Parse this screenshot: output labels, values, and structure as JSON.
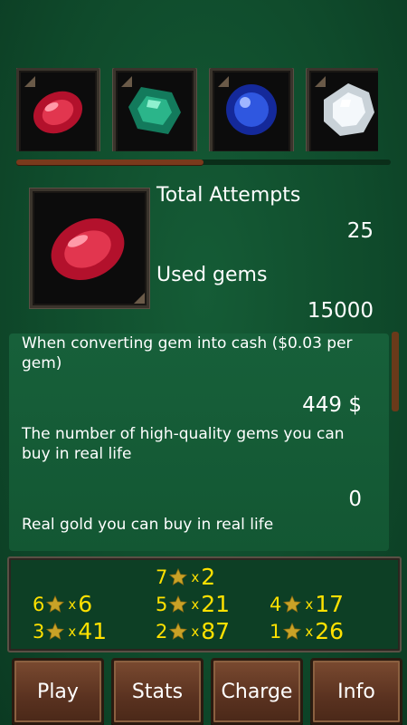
{
  "gems": {
    "strip": [
      {
        "name": "ruby",
        "color": "#c8203a"
      },
      {
        "name": "emerald",
        "color": "#1f9e7a"
      },
      {
        "name": "sapphire",
        "color": "#1e3fc4"
      },
      {
        "name": "diamond",
        "color": "#e8eef2"
      }
    ],
    "scroll_progress": 0.5,
    "selected": {
      "name": "ruby",
      "color": "#c8203a"
    }
  },
  "stats": {
    "total_attempts_label": "Total Attempts",
    "total_attempts_value": "25",
    "used_gems_label": "Used gems",
    "used_gems_value": "15000"
  },
  "conversion": {
    "cash_label": "When converting gem into cash ($0.03 per gem)",
    "cash_value": "449 $",
    "hq_label": "The number of high-quality gems you can buy in real life",
    "hq_value": "0",
    "gold_label": "Real gold you can buy in real life"
  },
  "star_counts": [
    {
      "stars": "7",
      "x": "x",
      "count": "2"
    },
    {
      "stars": "6",
      "x": "x",
      "count": "6"
    },
    {
      "stars": "5",
      "x": "x",
      "count": "21"
    },
    {
      "stars": "4",
      "x": "x",
      "count": "17"
    },
    {
      "stars": "3",
      "x": "x",
      "count": "41"
    },
    {
      "stars": "2",
      "x": "x",
      "count": "87"
    },
    {
      "stars": "1",
      "x": "x",
      "count": "26"
    }
  ],
  "buttons": {
    "play": "Play",
    "stats": "Stats",
    "charge": "Charge",
    "info": "Info"
  },
  "colors": {
    "felt": "#0f4a2b",
    "star": "#ffe100",
    "wood": "#5a3220"
  }
}
